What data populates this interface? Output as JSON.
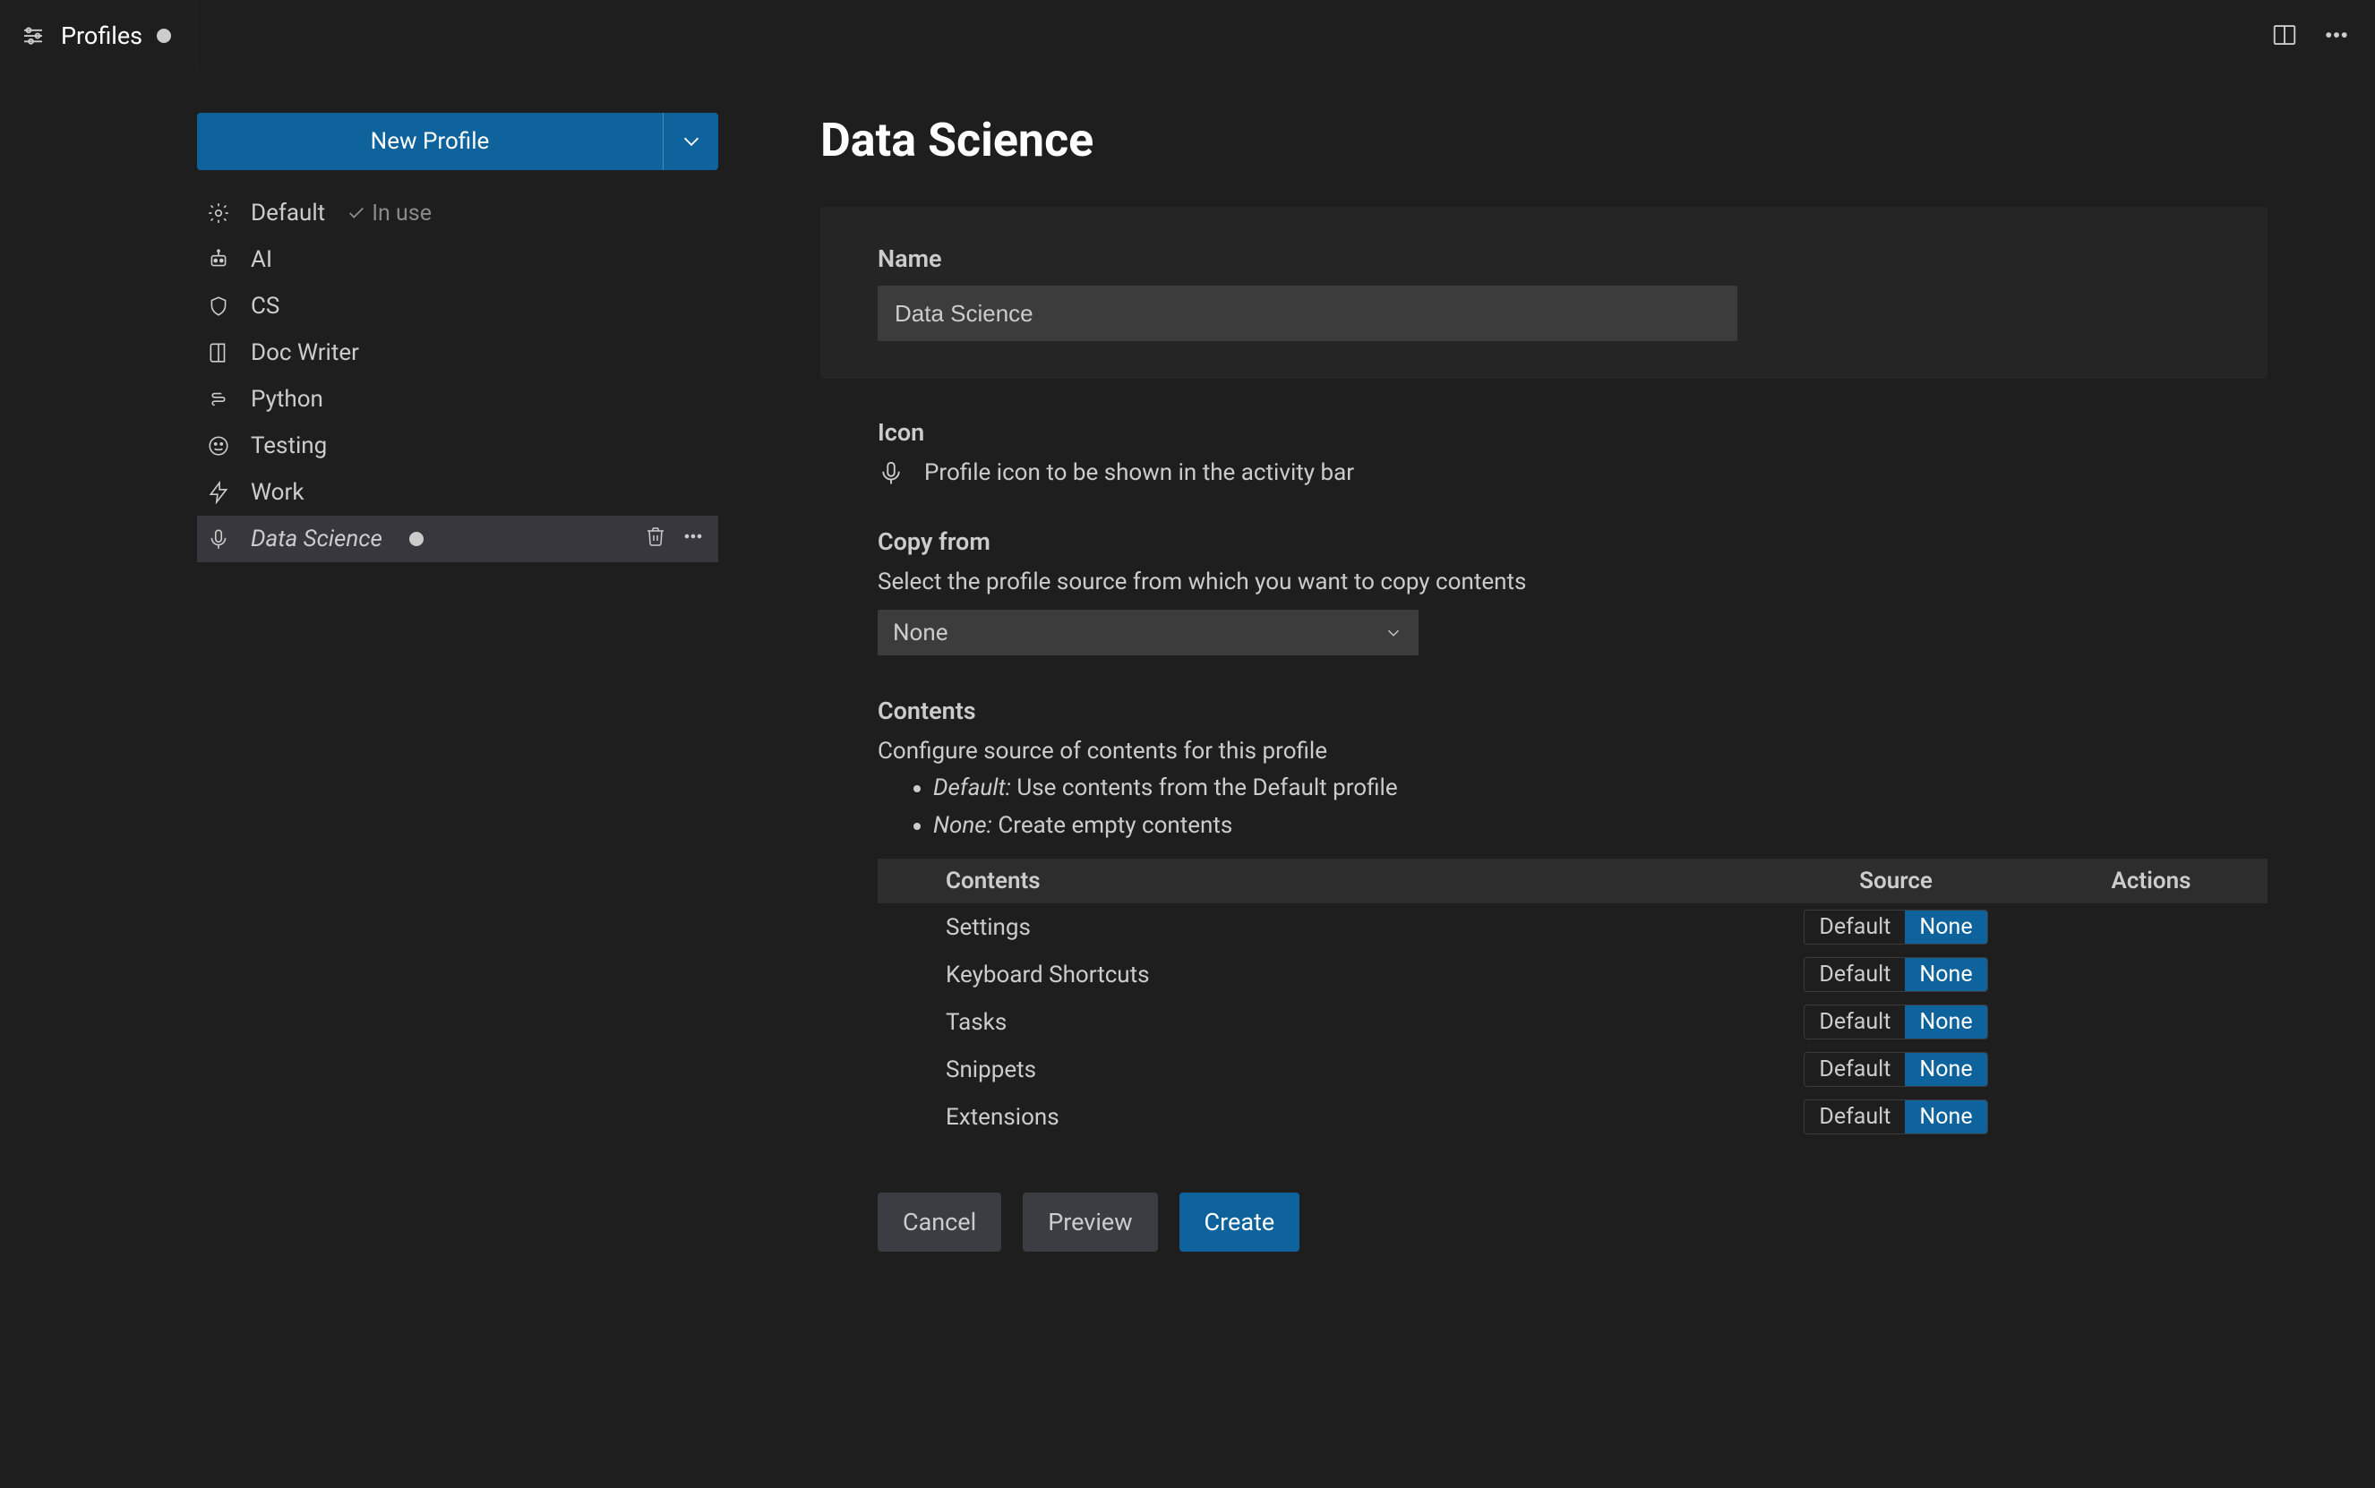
{
  "tab": {
    "title": "Profiles"
  },
  "sidebar": {
    "new_profile_label": "New Profile",
    "items": [
      {
        "label": "Default",
        "in_use": true,
        "selected": false,
        "icon": "gear",
        "dirty": false
      },
      {
        "label": "AI",
        "in_use": false,
        "selected": false,
        "icon": "robot",
        "dirty": false
      },
      {
        "label": "CS",
        "in_use": false,
        "selected": false,
        "icon": "shield",
        "dirty": false
      },
      {
        "label": "Doc Writer",
        "in_use": false,
        "selected": false,
        "icon": "book",
        "dirty": false
      },
      {
        "label": "Python",
        "in_use": false,
        "selected": false,
        "icon": "snake",
        "dirty": false
      },
      {
        "label": "Testing",
        "in_use": false,
        "selected": false,
        "icon": "smile",
        "dirty": false
      },
      {
        "label": "Work",
        "in_use": false,
        "selected": false,
        "icon": "bolt",
        "dirty": false
      },
      {
        "label": "Data Science",
        "in_use": false,
        "selected": true,
        "icon": "mic",
        "dirty": true
      }
    ],
    "in_use_label": "In use"
  },
  "form": {
    "title": "Data Science",
    "name_label": "Name",
    "name_value": "Data Science",
    "icon_label": "Icon",
    "icon_desc": "Profile icon to be shown in the activity bar",
    "copy_label": "Copy from",
    "copy_desc": "Select the profile source from which you want to copy contents",
    "copy_value": "None",
    "contents_label": "Contents",
    "contents_desc": "Configure source of contents for this profile",
    "bullet_default_key": "Default:",
    "bullet_default_txt": " Use contents from the Default profile",
    "bullet_none_key": "None:",
    "bullet_none_txt": " Create empty contents",
    "table_headers": {
      "contents": "Contents",
      "source": "Source",
      "actions": "Actions"
    },
    "rows": [
      {
        "label": "Settings",
        "source": "None",
        "options": [
          "Default",
          "None"
        ]
      },
      {
        "label": "Keyboard Shortcuts",
        "source": "None",
        "options": [
          "Default",
          "None"
        ]
      },
      {
        "label": "Tasks",
        "source": "None",
        "options": [
          "Default",
          "None"
        ]
      },
      {
        "label": "Snippets",
        "source": "None",
        "options": [
          "Default",
          "None"
        ]
      },
      {
        "label": "Extensions",
        "source": "None",
        "options": [
          "Default",
          "None"
        ]
      }
    ],
    "buttons": {
      "cancel": "Cancel",
      "preview": "Preview",
      "create": "Create"
    }
  }
}
